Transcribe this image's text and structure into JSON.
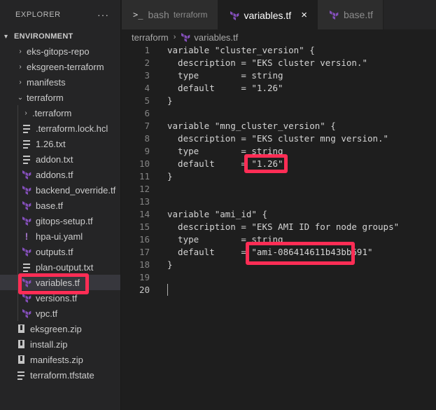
{
  "explorer": {
    "title": "EXPLORER",
    "more": "···",
    "section": "ENVIRONMENT",
    "items": [
      {
        "label": "eks-gitops-repo",
        "type": "folder"
      },
      {
        "label": "eksgreen-terraform",
        "type": "folder"
      },
      {
        "label": "manifests",
        "type": "folder"
      },
      {
        "label": "terraform",
        "type": "folder-open"
      },
      {
        "label": ".terraform",
        "type": "folder"
      },
      {
        "label": ".terraform.lock.hcl",
        "type": "file"
      },
      {
        "label": "1.26.txt",
        "type": "file"
      },
      {
        "label": "addon.txt",
        "type": "file"
      },
      {
        "label": "addons.tf",
        "type": "tf"
      },
      {
        "label": "backend_override.tf",
        "type": "tf"
      },
      {
        "label": "base.tf",
        "type": "tf"
      },
      {
        "label": "gitops-setup.tf",
        "type": "tf"
      },
      {
        "label": "hpa-ui.yaml",
        "type": "yaml"
      },
      {
        "label": "outputs.tf",
        "type": "tf"
      },
      {
        "label": "plan-output.txt",
        "type": "file"
      },
      {
        "label": "variables.tf",
        "type": "tf"
      },
      {
        "label": "versions.tf",
        "type": "tf"
      },
      {
        "label": "vpc.tf",
        "type": "tf"
      },
      {
        "label": "eksgreen.zip",
        "type": "zip"
      },
      {
        "label": "install.zip",
        "type": "zip"
      },
      {
        "label": "manifests.zip",
        "type": "zip"
      },
      {
        "label": "terraform.tfstate",
        "type": "file"
      }
    ]
  },
  "tabs": [
    {
      "label": "bash",
      "description": "terraform",
      "icon": "terminal-icon"
    },
    {
      "label": "variables.tf",
      "icon": "terraform-icon",
      "close": "×"
    },
    {
      "label": "base.tf",
      "icon": "terraform-icon"
    }
  ],
  "breadcrumb": {
    "folder": "terraform",
    "file": "variables.tf"
  },
  "code_lines": [
    {
      "n": "1",
      "text": "variable \"cluster_version\" {"
    },
    {
      "n": "2",
      "text": "  description = \"EKS cluster version.\""
    },
    {
      "n": "3",
      "text": "  type        = string"
    },
    {
      "n": "4",
      "text": "  default     = \"1.26\""
    },
    {
      "n": "5",
      "text": "}"
    },
    {
      "n": "6",
      "text": ""
    },
    {
      "n": "7",
      "text": "variable \"mng_cluster_version\" {"
    },
    {
      "n": "8",
      "text": "  description = \"EKS cluster mng version.\""
    },
    {
      "n": "9",
      "text": "  type        = string"
    },
    {
      "n": "10",
      "text": "  default     = \"1.26\""
    },
    {
      "n": "11",
      "text": "}"
    },
    {
      "n": "12",
      "text": ""
    },
    {
      "n": "13",
      "text": ""
    },
    {
      "n": "14",
      "text": "variable \"ami_id\" {"
    },
    {
      "n": "15",
      "text": "  description = \"EKS AMI ID for node groups\""
    },
    {
      "n": "16",
      "text": "  type        = string"
    },
    {
      "n": "17",
      "text": "  default     = \"ami-086414611b43bb691\""
    },
    {
      "n": "18",
      "text": "}"
    },
    {
      "n": "19",
      "text": ""
    },
    {
      "n": "20",
      "text": ""
    }
  ],
  "colors": {
    "highlight": "#ff2d55",
    "terraform": "#844fba"
  }
}
